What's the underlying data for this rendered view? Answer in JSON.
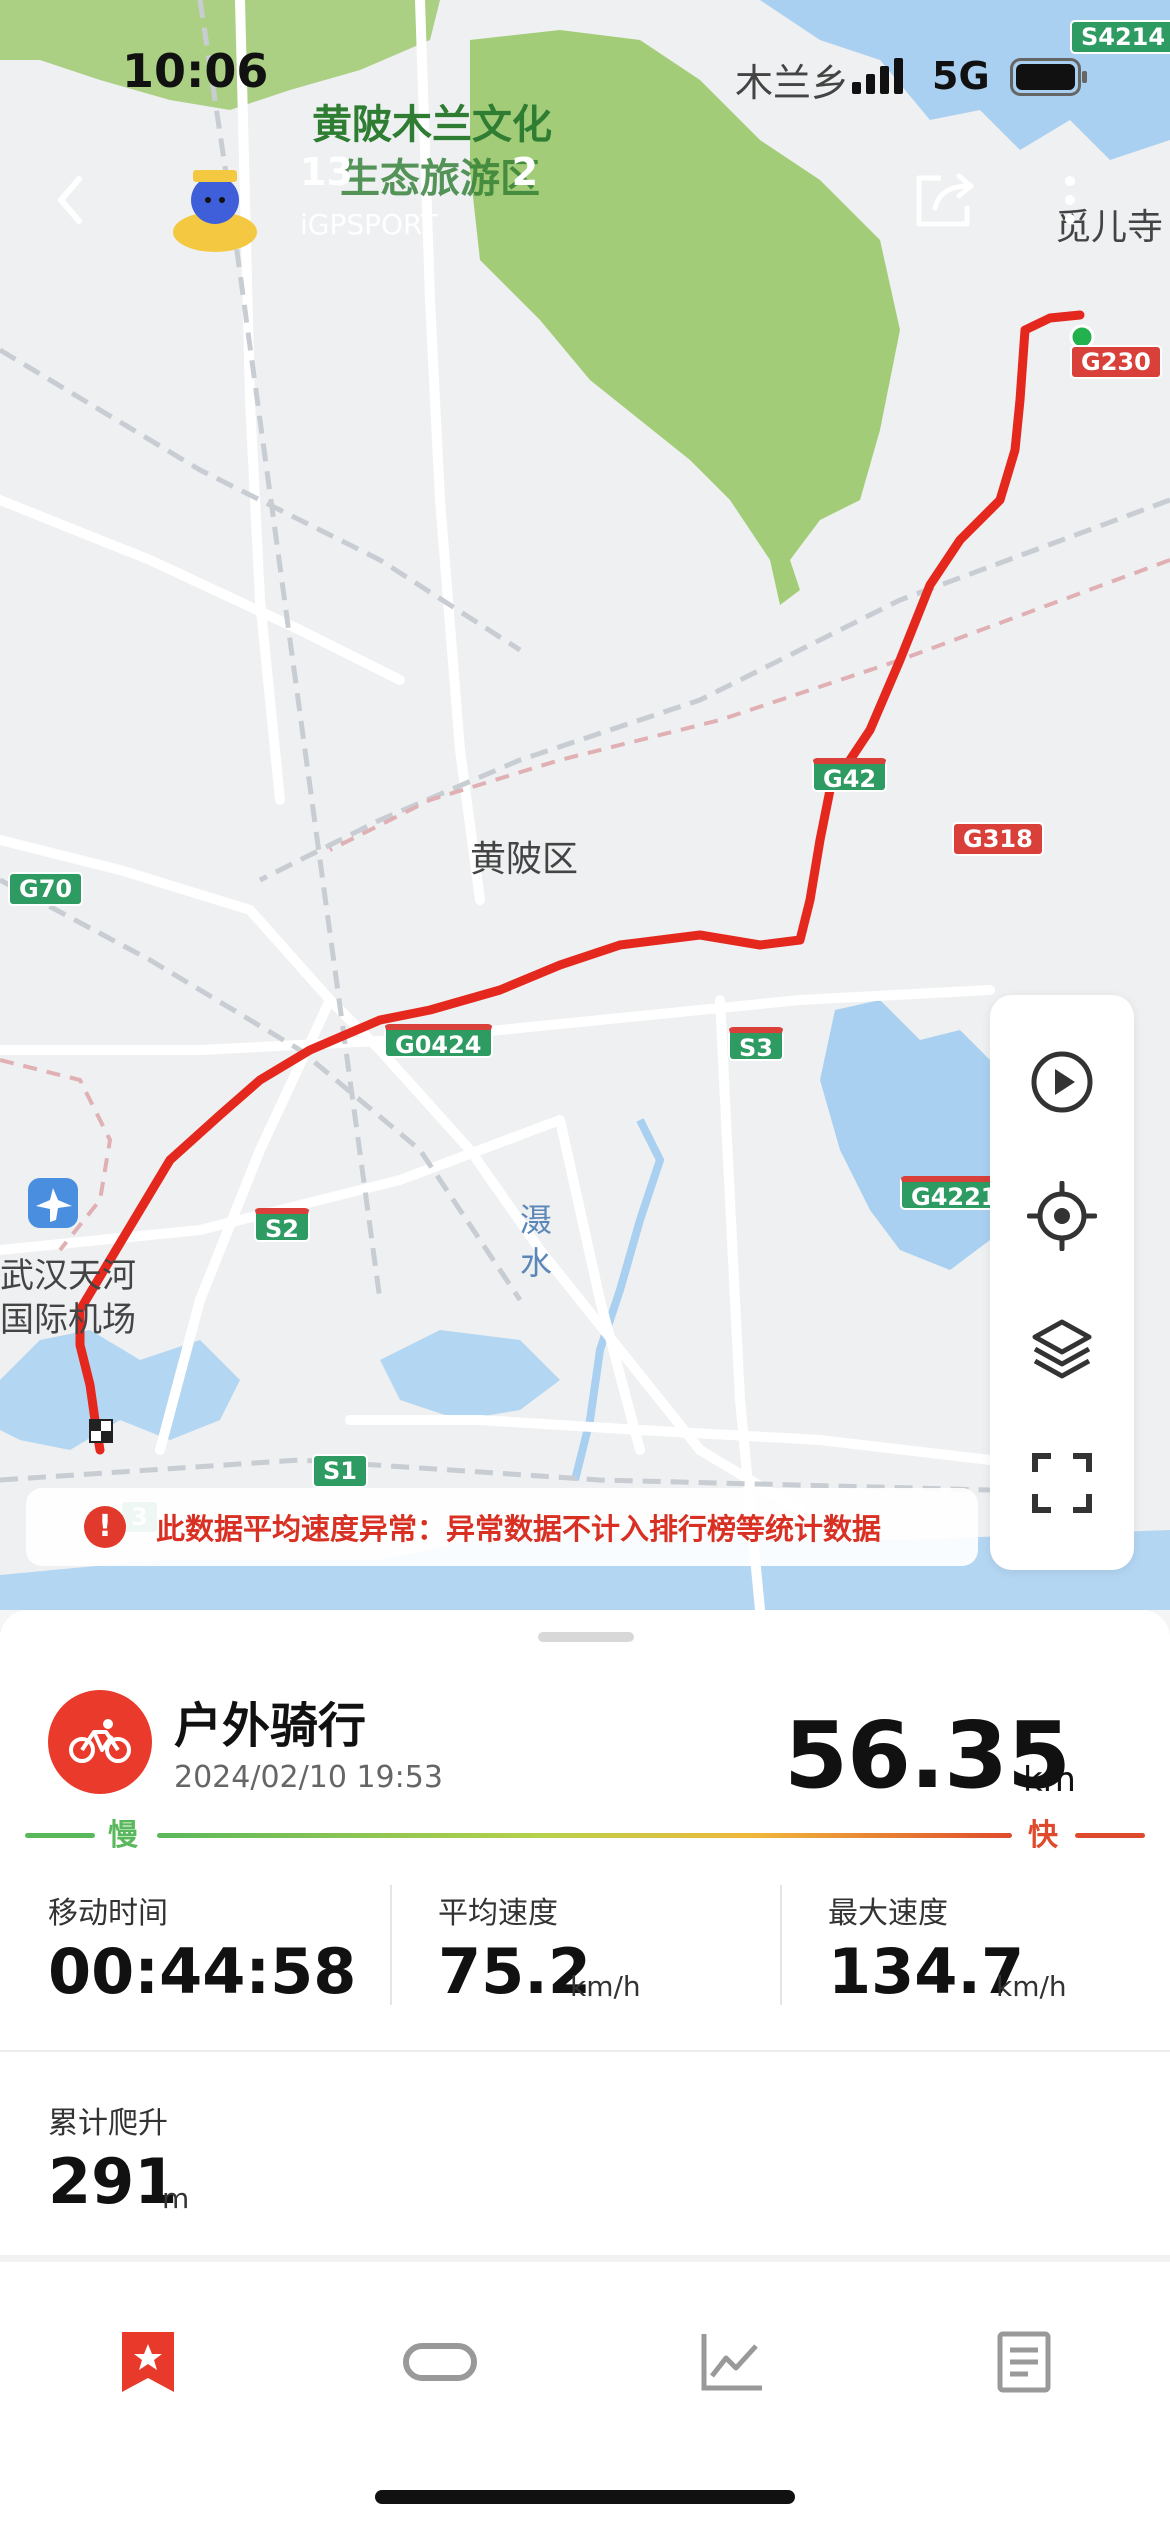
{
  "status_bar": {
    "time": "10:06",
    "carrier_text": "木兰乡",
    "network": "5G"
  },
  "header": {
    "overlay_place_1": "黄陂木兰文化",
    "overlay_place_2": "生态旅游区",
    "user_id": "13            2",
    "app_name": "iGPSPORT",
    "place_right": "觅儿寺"
  },
  "map": {
    "district": "黄陂区",
    "river": [
      "滠",
      "水"
    ],
    "airport_1": "武汉天河",
    "airport_2": "国际机场",
    "roads": {
      "s4214": "S4214",
      "g230": "G230",
      "g42": "G42",
      "g318": "G318",
      "g70": "G70",
      "g0424": "G0424",
      "s3": "S3",
      "s2": "S2",
      "g4221": "G4221",
      "s1": "S1",
      "g3": "3"
    }
  },
  "warning": {
    "icon": "!",
    "text": "此数据平均速度异常：异常数据不计入排行榜等统计数据"
  },
  "activity": {
    "type": "户外骑行",
    "datetime": "2024/02/10 19:53",
    "distance": "56.35",
    "distance_unit": "km",
    "slow_label": "慢",
    "fast_label": "快"
  },
  "metrics": {
    "moving_time_label": "移动时间",
    "moving_time": "00:44:58",
    "avg_speed_label": "平均速度",
    "avg_speed": "75.2",
    "avg_speed_unit": "km/h",
    "max_speed_label": "最大速度",
    "max_speed": "134.7",
    "max_speed_unit": "km/h",
    "climb_label": "累计爬升",
    "climb": "291",
    "climb_unit": "m"
  },
  "icons": {
    "back": "chevron-left-icon",
    "share": "share-icon",
    "more": "more-vertical-icon",
    "play": "play-icon",
    "locate": "locate-icon",
    "layers": "layers-icon",
    "fullscreen": "fullscreen-icon",
    "bike": "bike-icon",
    "tabs": [
      "bookmark-star-icon",
      "device-icon",
      "chart-icon",
      "document-icon"
    ]
  },
  "colors": {
    "accent": "#e8392b",
    "route": "#e5281e",
    "slow": "#5ab85c",
    "fast": "#e04a2c"
  }
}
